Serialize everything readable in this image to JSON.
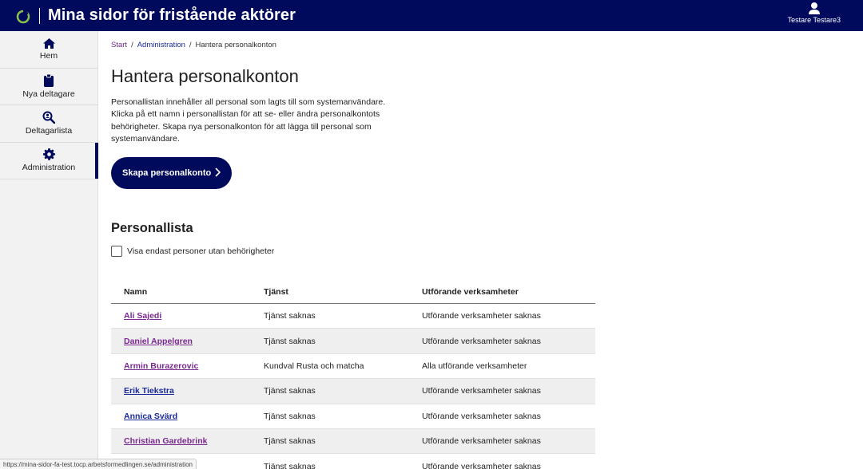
{
  "header": {
    "title": "Mina sidor för fristående aktörer",
    "user_name": "Testare Testare3"
  },
  "sidebar": {
    "items": [
      {
        "label": "Hem",
        "icon": "home-icon"
      },
      {
        "label": "Nya deltagare",
        "icon": "clipboard-icon"
      },
      {
        "label": "Deltagarlista",
        "icon": "search-user-icon"
      },
      {
        "label": "Administration",
        "icon": "gear-icon",
        "active": true
      }
    ]
  },
  "breadcrumb": {
    "items": [
      "Start",
      "Administration",
      "Hantera personalkonton"
    ],
    "separator": "/"
  },
  "main": {
    "title": "Hantera personalkonton",
    "intro": "Personallistan innehåller all personal som lagts till som systemanvändare. Klicka på ett namn i personallistan för att se- eller ändra personalkontots behörigheter. Skapa nya personalkonton för att lägga till personal som systemanvändare.",
    "create_button": "Skapa personalkonto",
    "section_title": "Personallista",
    "filter_label": "Visa endast personer utan behörigheter",
    "filter_checked": false
  },
  "table": {
    "headers": [
      "Namn",
      "Tjänst",
      "Utförande verksamheter"
    ],
    "rows": [
      {
        "name": "Ali Sajedi",
        "service": "Tjänst saknas",
        "operations": "Utförande verksamheter saknas",
        "link_color": "purple"
      },
      {
        "name": "Daniel Appelgren",
        "service": "Tjänst saknas",
        "operations": "Utförande verksamheter saknas",
        "link_color": "purple"
      },
      {
        "name": "Armin Burazerovic",
        "service": "Kundval Rusta och matcha",
        "operations": "Alla utförande verksamheter",
        "link_color": "purple"
      },
      {
        "name": "Erik Tiekstra",
        "service": "Tjänst saknas",
        "operations": "Utförande verksamheter saknas",
        "link_color": "blue"
      },
      {
        "name": "Annica Svärd",
        "service": "Tjänst saknas",
        "operations": "Utförande verksamheter saknas",
        "link_color": "blue"
      },
      {
        "name": "Christian Gardebrink",
        "service": "Tjänst saknas",
        "operations": "Utförande verksamheter saknas",
        "link_color": "purple"
      },
      {
        "name": "",
        "service": "Tjänst saknas",
        "operations": "Utförande verksamheter saknas",
        "link_color": "purple"
      }
    ]
  },
  "status_bar": {
    "url": "https://mina-sidor-fa-test.tocp.arbetsformedlingen.se/administration"
  },
  "colors": {
    "brand_navy": "#000a5c",
    "link_purple": "#7a2a8f",
    "link_blue": "#1a2a9a",
    "logo_green": "#8bc34a"
  }
}
